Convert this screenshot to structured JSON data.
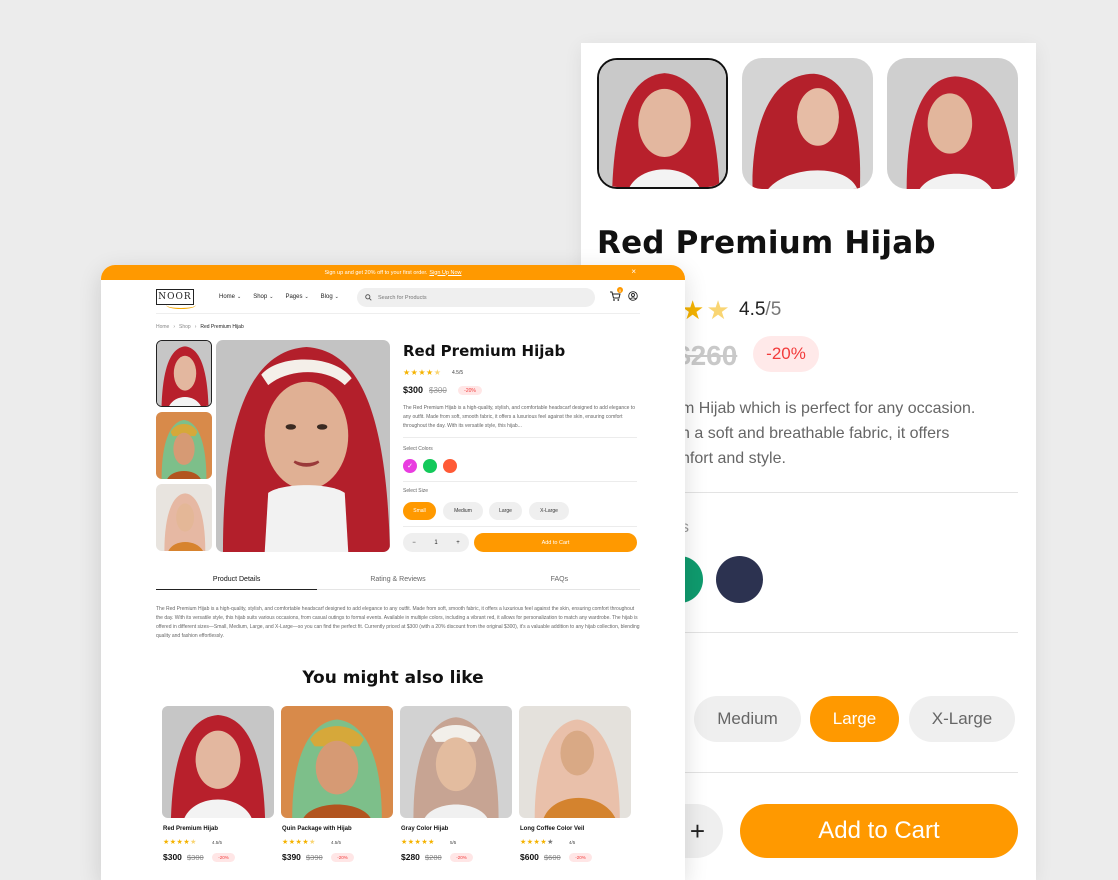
{
  "colors": {
    "accent": "#ff9900",
    "discount": "#f23b3b",
    "star": "#f5b301"
  },
  "zoom": {
    "title": "Red Premium Hijab",
    "rating_value": "4.5",
    "rating_den": "/5",
    "old_price": "$260",
    "discount": "-20%",
    "desc_lines": [
      "m Hijab which is perfect for any occasion.",
      "n a soft and breathable fabric, it offers",
      "nfort and style."
    ],
    "colors_label": "s",
    "colors": [
      "#0f9b6e",
      "#2c3250"
    ],
    "sizes": [
      {
        "label": "Medium",
        "selected": false
      },
      {
        "label": "Large",
        "selected": true
      },
      {
        "label": "X-Large",
        "selected": false
      }
    ],
    "qty_plus": "+",
    "add_to_cart": "Add to Cart"
  },
  "page": {
    "promo_text": "Sign up and get 20% off to your first order.",
    "promo_link": "Sign Up Now",
    "promo_close": "×",
    "logo": "NOOR",
    "menu": [
      "Home",
      "Shop",
      "Pages",
      "Blog"
    ],
    "search_placeholder": "Search for Products",
    "cart_count": "0",
    "breadcrumb": [
      "Home",
      "Shop",
      "Red Premium Hijab"
    ],
    "product": {
      "title": "Red Premium Hijab",
      "rating": "4.5/5",
      "price": "$300",
      "old_price": "$300",
      "discount": "-20%",
      "description": "The Red Premium Hijab is a high-quality, stylish, and comfortable headscarf designed to add elegance to any outfit. Made from soft, smooth fabric, it offers a luxurious feel against the skin, ensuring comfort throughout the day. With its versatile style, this hijab...",
      "colors_label": "Select Colors",
      "colors": [
        "#e93ce0",
        "#13c95a",
        "#ff5a36"
      ],
      "size_label": "Select Size",
      "sizes": [
        {
          "label": "Small",
          "selected": true
        },
        {
          "label": "Medium",
          "selected": false
        },
        {
          "label": "Large",
          "selected": false
        },
        {
          "label": "X-Large",
          "selected": false
        }
      ],
      "qty": "1",
      "add_to_cart": "Add to Cart"
    },
    "tabs": [
      "Product Details",
      "Rating & Reviews",
      "FAQs"
    ],
    "details": "The Red Premium Hijab is a high-quality, stylish, and comfortable headscarf designed to add elegance to any outfit. Made from soft, smooth fabric, it offers a luxurious feel against the skin, ensuring comfort throughout the day. With its versatile style, this hijab suits various occasions, from casual outings to formal events. Available in multiple colors, including a vibrant red, it allows for personalization to match any wardrobe. The hijab is offered in different sizes—Small, Medium, Large, and X-Large—so you can find the perfect fit. Currently priced at $300 (with a 20% discount from the original $300), it's a valuable addition to any hijab collection, blending quality and fashion effortlessly.",
    "also_title": "You might also like",
    "related": [
      {
        "name": "Red Premium Hijab",
        "rating": "4.5/5",
        "price": "$300",
        "old_price": "$300",
        "discount": "-20%"
      },
      {
        "name": "Quin Package with Hijab",
        "rating": "4.5/5",
        "price": "$390",
        "old_price": "$390",
        "discount": "-20%"
      },
      {
        "name": "Gray Color Hijab",
        "rating": "5/5",
        "price": "$280",
        "old_price": "$280",
        "discount": "-20%"
      },
      {
        "name": "Long Coffee Color Veil",
        "rating": "4/5",
        "price": "$600",
        "old_price": "$600",
        "discount": "-20%"
      }
    ]
  },
  "icons": [
    "search-icon",
    "cart-icon",
    "user-icon",
    "chevron-down-icon",
    "star-icon",
    "check-icon",
    "close-icon"
  ]
}
